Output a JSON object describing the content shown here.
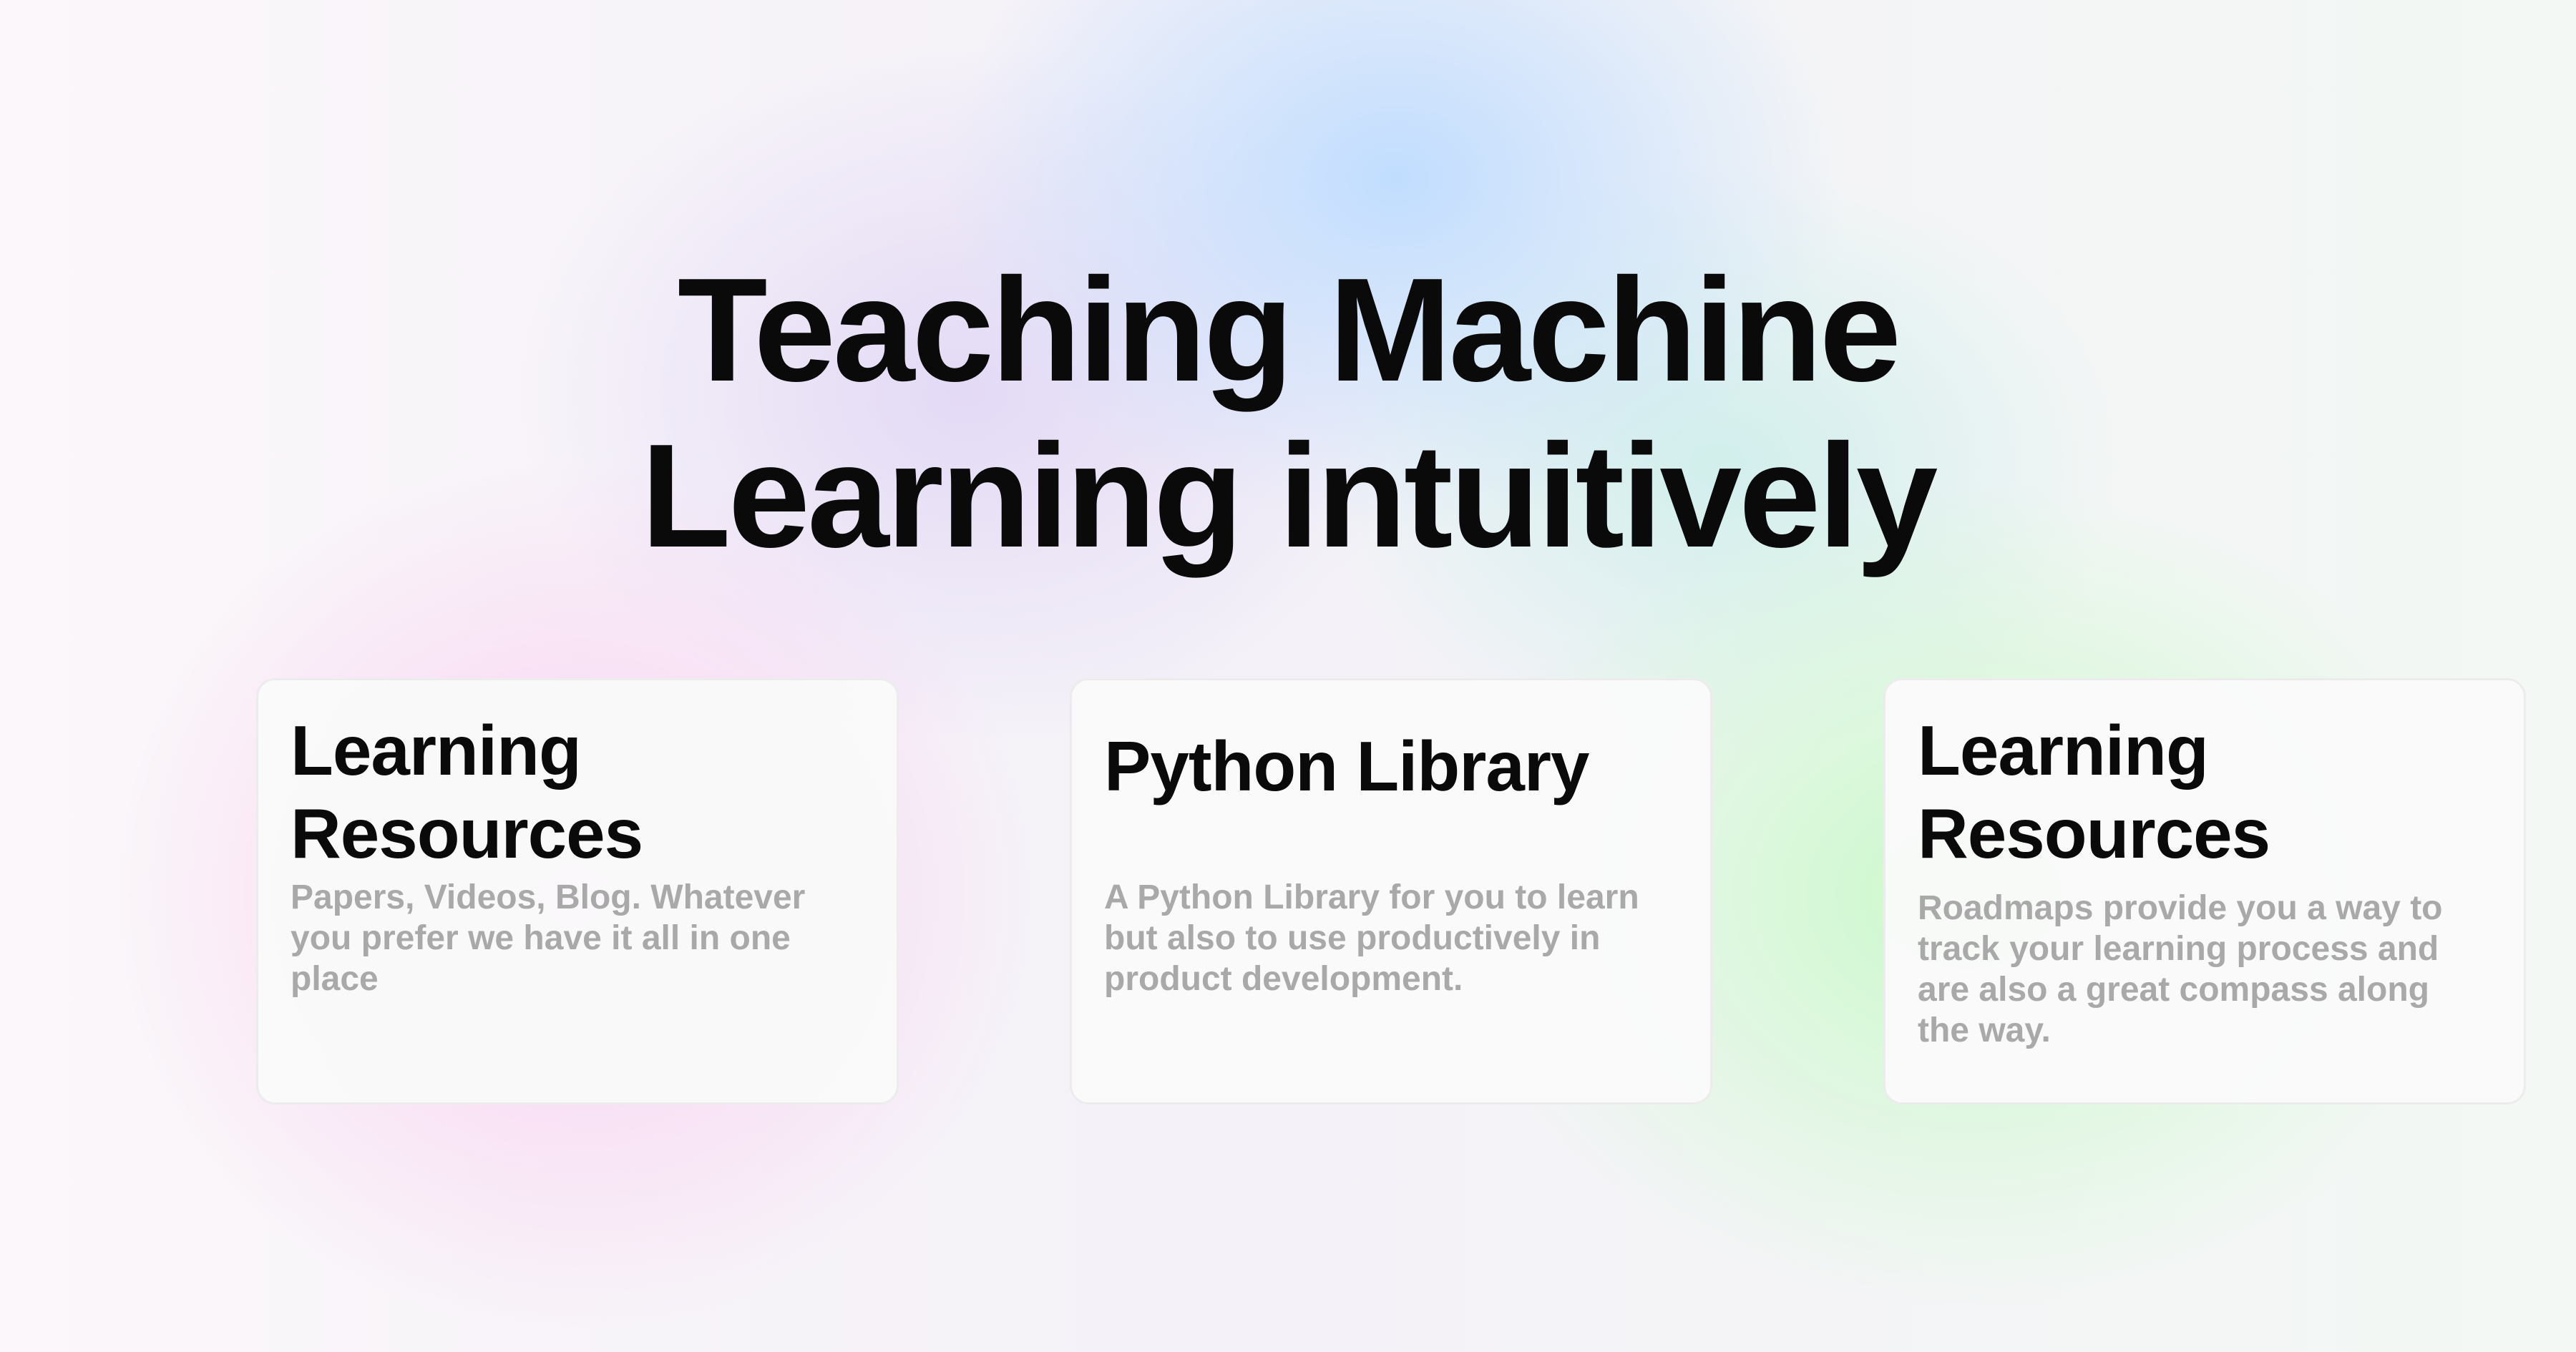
{
  "hero": {
    "title_line1": "Teaching Machine",
    "title_line2": "Learning intuitively"
  },
  "cards": [
    {
      "title": "Learning Resources",
      "description": "Papers, Videos, Blog. Whatever you prefer we have it all in one place"
    },
    {
      "title": "Python Library",
      "description": "A Python Library for you to learn but also to use productively in product development."
    },
    {
      "title": "Learning Resources",
      "description": "Roadmaps provide you a way to track your learning process and are also a great compass along the way."
    }
  ],
  "colors": {
    "text": "#0a0a0a",
    "muted_text": "#a9a9a9",
    "card_bg": "#fafafa",
    "card_border": "#ececec",
    "gradient_pink": "#facdf0",
    "gradient_blue": "#bedcff",
    "gradient_green": "#c8fac8"
  }
}
